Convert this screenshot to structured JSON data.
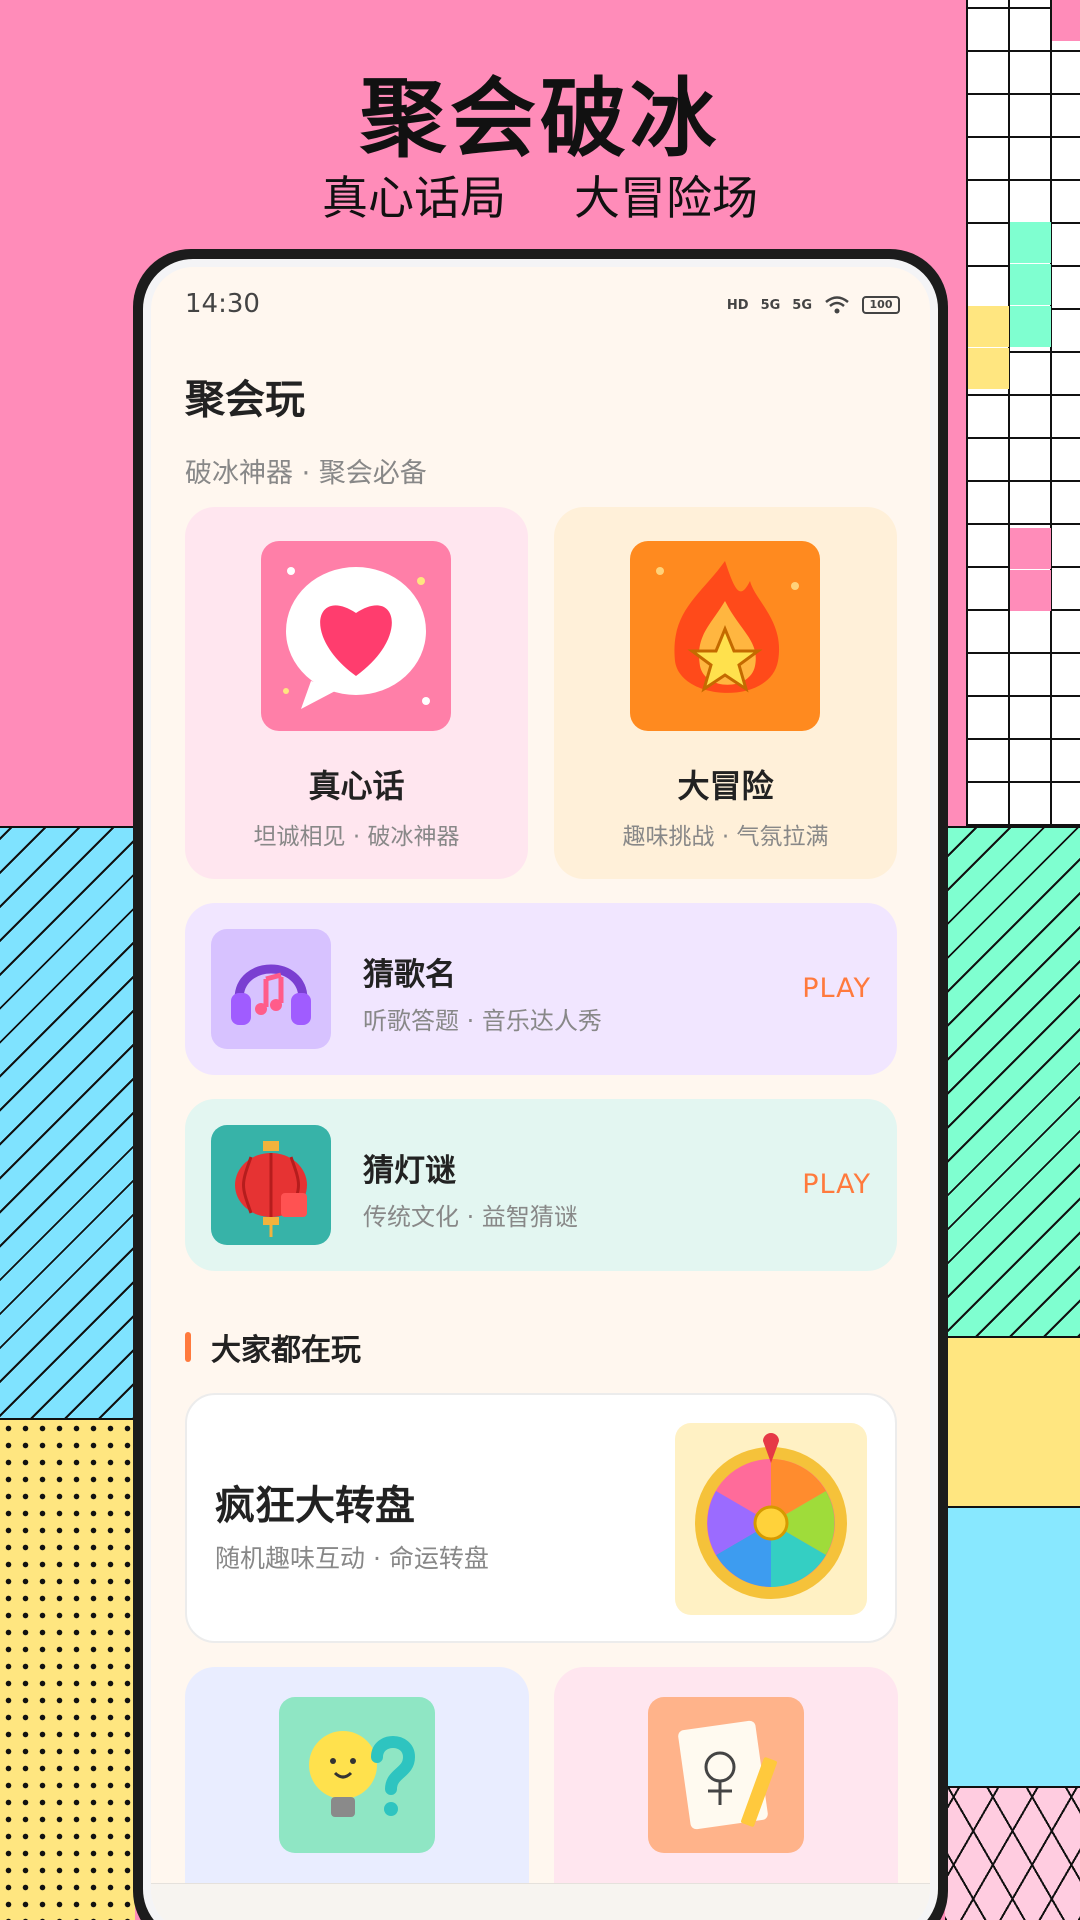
{
  "hero": {
    "title": "聚会破冰",
    "sub_left": "真心话局",
    "sub_right": "大冒险场"
  },
  "status_bar": {
    "time": "14:30",
    "hd": "HD",
    "net1": "5G",
    "net2": "5G",
    "battery": "100"
  },
  "header": {
    "title": "聚会玩",
    "subtitle": "破冰神器 · 聚会必备"
  },
  "big_cards": [
    {
      "title": "真心话",
      "subtitle": "坦诚相见 · 破冰神器",
      "icon": "heart-speech-icon",
      "bg": "#ffe6ef"
    },
    {
      "title": "大冒险",
      "subtitle": "趣味挑战 · 气氛拉满",
      "icon": "fire-star-icon",
      "bg": "#fff0d9"
    }
  ],
  "row_cards": [
    {
      "title": "猜歌名",
      "subtitle": "听歌答题 · 音乐达人秀",
      "action": "PLAY",
      "icon": "headphones-icon",
      "bg": "#f1e6ff"
    },
    {
      "title": "猜灯谜",
      "subtitle": "传统文化 · 益智猜谜",
      "action": "PLAY",
      "icon": "lantern-puzzle-icon",
      "bg": "#e3f6f1"
    }
  ],
  "section": {
    "title": "大家都在玩"
  },
  "featured": {
    "title": "疯狂大转盘",
    "subtitle": "随机趣味互动 · 命运转盘",
    "icon": "wheel-icon"
  },
  "bottom_cards": [
    {
      "icon": "lightbulb-question-icon",
      "bg": "#e9edff"
    },
    {
      "icon": "notebook-pencil-icon",
      "bg": "#ffe6ef"
    }
  ],
  "colors": {
    "accent": "#ff7a3d",
    "page_bg": "#ff8cb9"
  }
}
